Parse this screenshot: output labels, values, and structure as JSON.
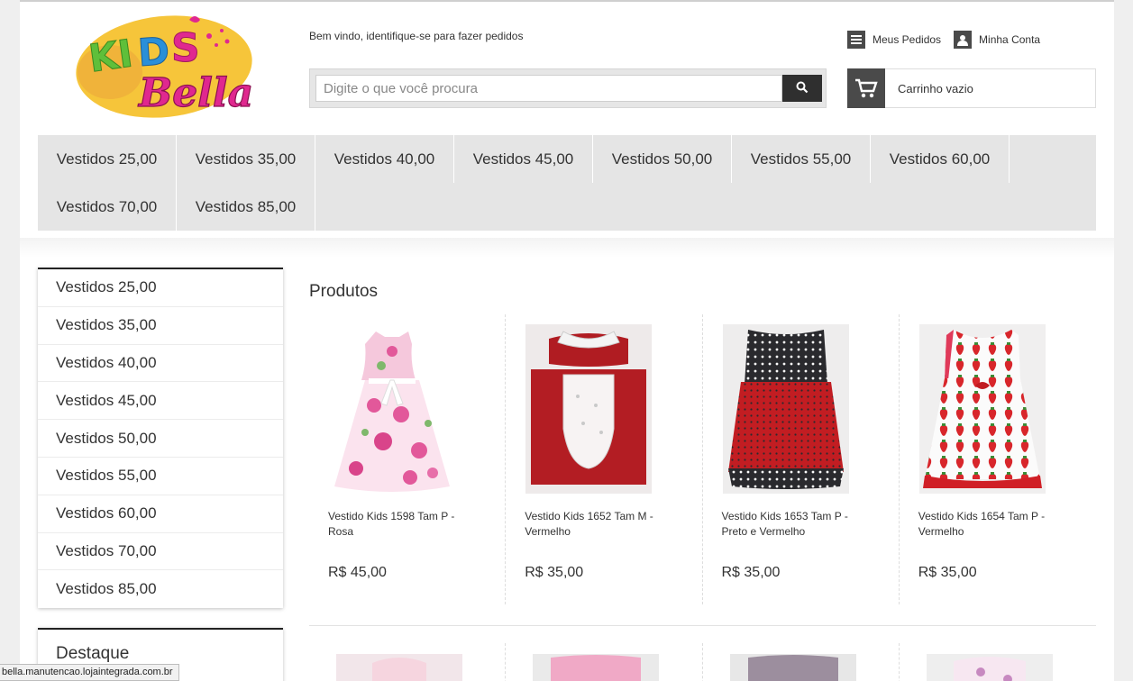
{
  "header": {
    "logo_text_top": "KIDS",
    "logo_text_bottom": "Bella",
    "welcome": "Bem vindo, identifique-se para fazer pedidos",
    "search_placeholder": "Digite o que você procura",
    "meus_pedidos": "Meus Pedidos",
    "minha_conta": "Minha Conta",
    "cart_label": "Carrinho vazio"
  },
  "catnav": [
    "Vestidos 25,00",
    "Vestidos 35,00",
    "Vestidos 40,00",
    "Vestidos 45,00",
    "Vestidos 50,00",
    "Vestidos 55,00",
    "Vestidos 60,00",
    "Vestidos 70,00",
    "Vestidos 85,00"
  ],
  "sidebar": {
    "items": [
      "Vestidos 25,00",
      "Vestidos 35,00",
      "Vestidos 40,00",
      "Vestidos 45,00",
      "Vestidos 50,00",
      "Vestidos 55,00",
      "Vestidos 60,00",
      "Vestidos 70,00",
      "Vestidos 85,00"
    ],
    "destaque": "Destaque"
  },
  "products": {
    "title": "Produtos",
    "items": [
      {
        "name": "Vestido Kids 1598 Tam P - Rosa",
        "price": "R$ 45,00"
      },
      {
        "name": "Vestido Kids 1652 Tam M - Vermelho",
        "price": "R$ 35,00"
      },
      {
        "name": "Vestido Kids 1653 Tam P - Preto e Vermelho",
        "price": "R$ 35,00"
      },
      {
        "name": "Vestido Kids 1654 Tam P - Vermelho",
        "price": "R$ 35,00"
      }
    ]
  },
  "statusbar": "bella.manutencao.lojaintegrada.com.br",
  "colors": {
    "nav_bg": "#e5e5e5",
    "dark_icon": "#4a4a4a",
    "logo_yellow": "#f6c53a",
    "logo_pink": "#e0288f"
  }
}
